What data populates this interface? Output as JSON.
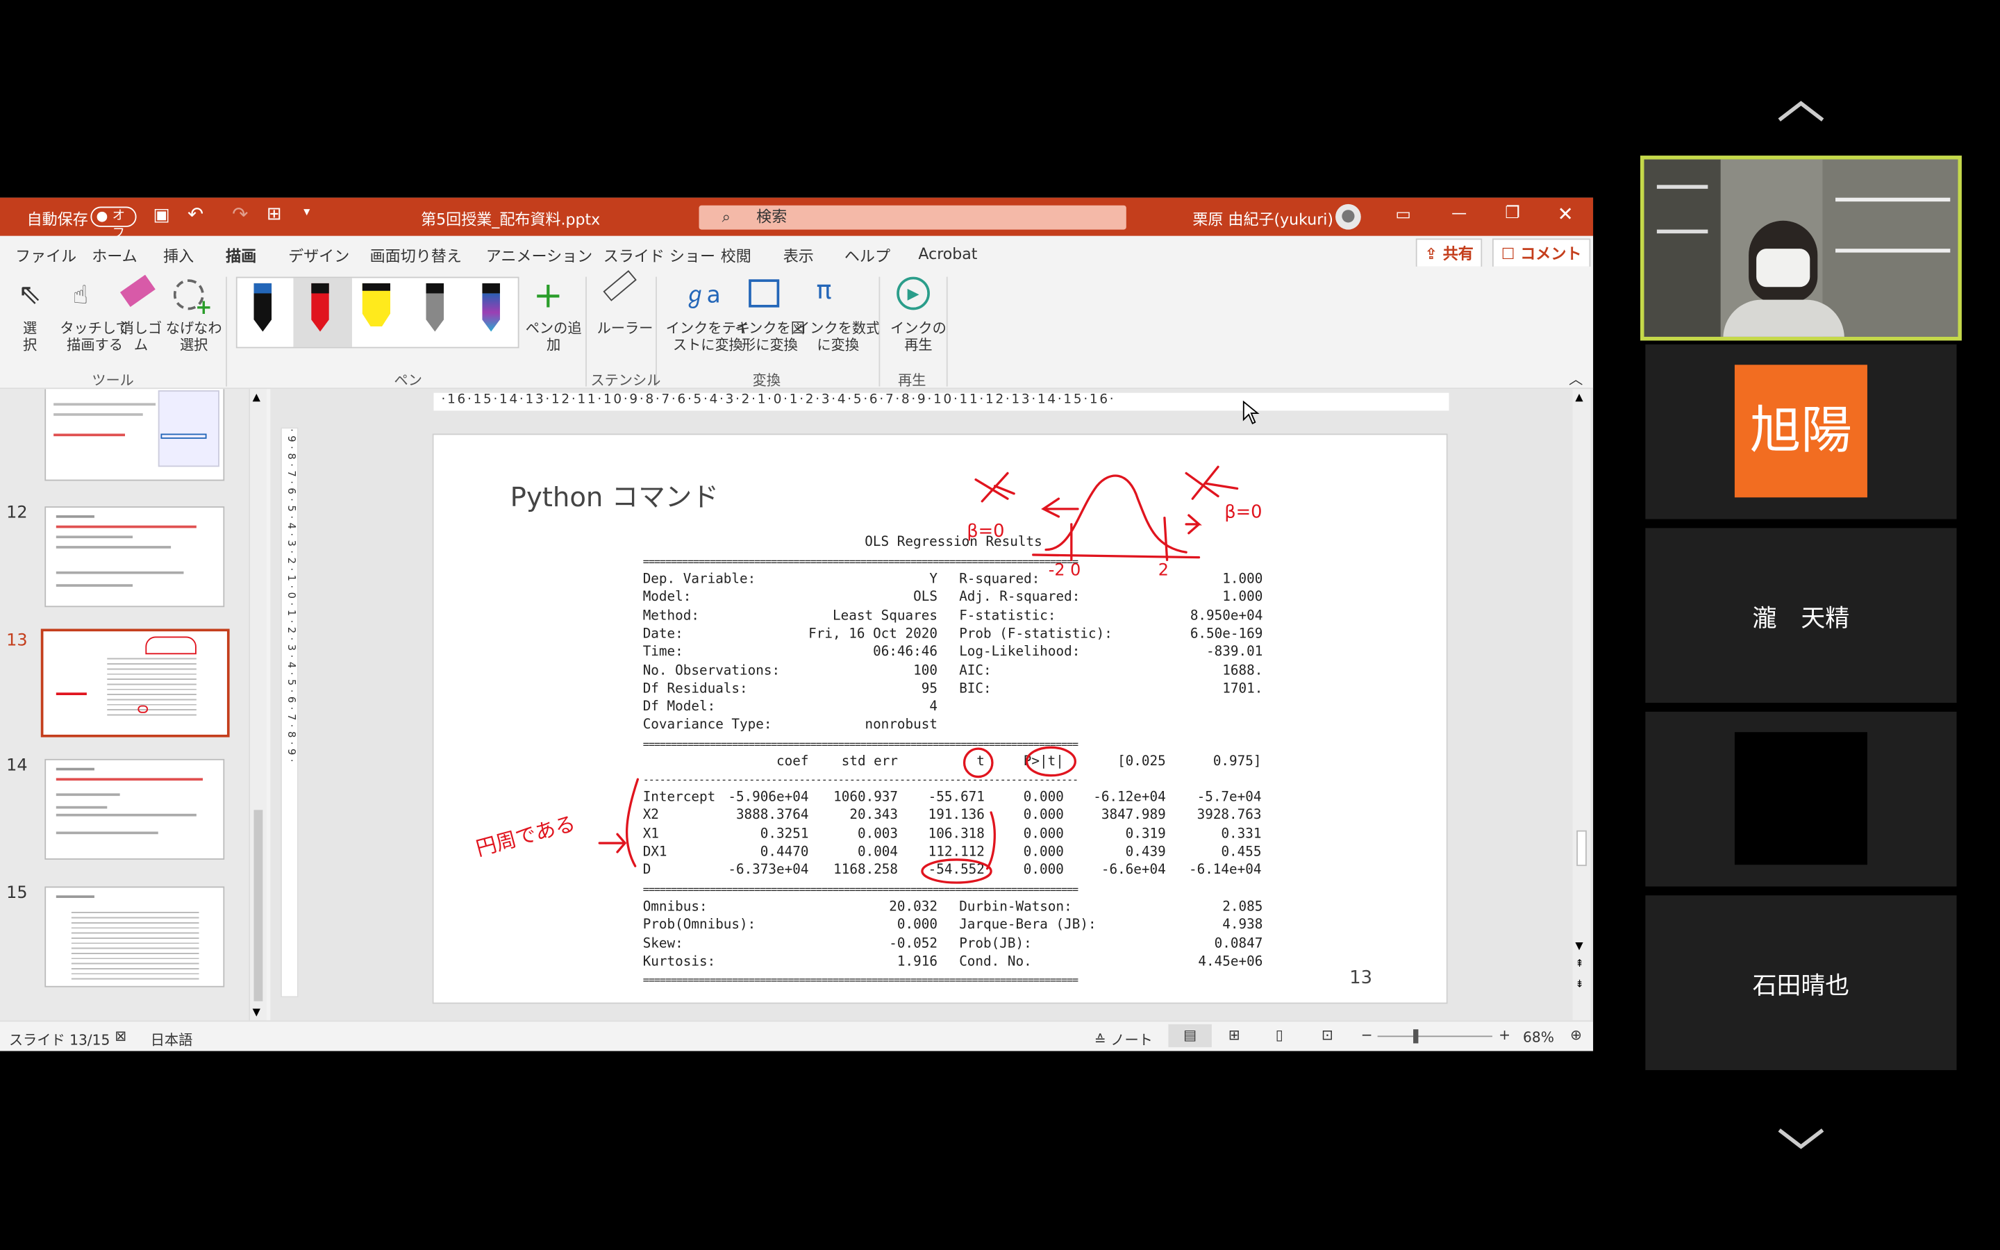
{
  "titlebar": {
    "autosave": "自動保存",
    "autosave_state": "オフ",
    "filename": "第5回授業_配布資料.pptx",
    "search_placeholder": "検索",
    "user": "栗原 由紀子(yukuri)"
  },
  "menu": [
    "ファイル",
    "ホーム",
    "挿入",
    "描画",
    "デザイン",
    "画面切り替え",
    "アニメーション",
    "スライド ショー",
    "校閲",
    "表示",
    "ヘルプ",
    "Acrobat"
  ],
  "share": "共有",
  "comment": "コメント",
  "ribbon": {
    "select": "選\n択",
    "touch": "タッチして\n描画する",
    "eraser": "消しゴ\nム",
    "lasso": "なげなわ\n選択",
    "add_pen": "ペンの追\n加",
    "ruler": "ルーラー",
    "ink_text": "インクをテキ\nストに変換",
    "ink_shape": "インクを図\n形に変換",
    "ink_math": "インクを数式\nに変換",
    "ink_replay": "インクの\n再生",
    "groups": {
      "tools": "ツール",
      "pens": "ペン",
      "stencil": "ステンシル",
      "convert": "変換",
      "replay": "再生"
    }
  },
  "thumbs": [
    "12",
    "13",
    "14",
    "15"
  ],
  "slide": {
    "title": "Python コマンド",
    "header": "OLS Regression Results",
    "sep": "==============================================================================",
    "sep2": "------------------------------------------------------------------------------",
    "info_left": [
      "Dep. Variable:",
      "Model:",
      "Method:",
      "Date:",
      "Time:",
      "No. Observations:",
      "Df Residuals:",
      "Df Model:",
      "Covariance Type:"
    ],
    "info_left_val": [
      "Y",
      "OLS",
      "Least Squares",
      "Fri, 16 Oct 2020",
      "06:46:46",
      "100",
      "95",
      "4",
      "nonrobust"
    ],
    "info_right": [
      "R-squared:",
      "Adj. R-squared:",
      "F-statistic:",
      "Prob (F-statistic):",
      "Log-Likelihood:",
      "AIC:",
      "BIC:"
    ],
    "info_right_val": [
      "1.000",
      "1.000",
      "8.950e+04",
      "6.50e-169",
      "-839.01",
      "1688.",
      "1701."
    ],
    "coef_header": [
      "coef",
      "std err",
      "t",
      "P>|t|",
      "[0.025",
      "0.975]"
    ],
    "coef_rows": [
      [
        "Intercept",
        "-5.906e+04",
        "1060.937",
        "-55.671",
        "0.000",
        "-6.12e+04",
        "-5.7e+04"
      ],
      [
        "X2",
        "3888.3764",
        "20.343",
        "191.136",
        "0.000",
        "3847.989",
        "3928.763"
      ],
      [
        "X1",
        "0.3251",
        "0.003",
        "106.318",
        "0.000",
        "0.319",
        "0.331"
      ],
      [
        "DX1",
        "0.4470",
        "0.004",
        "112.112",
        "0.000",
        "0.439",
        "0.455"
      ],
      [
        "D",
        "-6.373e+04",
        "1168.258",
        "-54.552",
        "0.000",
        "-6.6e+04",
        "-6.14e+04"
      ]
    ],
    "diag_left": [
      "Omnibus:",
      "Prob(Omnibus):",
      "Skew:",
      "Kurtosis:"
    ],
    "diag_left_val": [
      "20.032",
      "0.000",
      "-0.052",
      "1.916"
    ],
    "diag_right": [
      "Durbin-Watson:",
      "Jarque-Bera (JB):",
      "Prob(JB):",
      "Cond. No."
    ],
    "diag_right_val": [
      "2.085",
      "4.938",
      "0.0847",
      "4.45e+06"
    ],
    "page": "13"
  },
  "status": {
    "slide": "スライド 13/15",
    "lang": "日本語",
    "notes": "ノート",
    "zoom": "68%"
  },
  "participants": [
    {
      "name": "旭陽"
    },
    {
      "name": "瀧　天精"
    },
    {
      "name": ""
    },
    {
      "name": "石田晴也"
    }
  ],
  "colors": {
    "titlebar": "#c43e1c",
    "accent": "#c43e1c",
    "zoom_tile": "#f26d21",
    "ink": "#e0141e"
  }
}
